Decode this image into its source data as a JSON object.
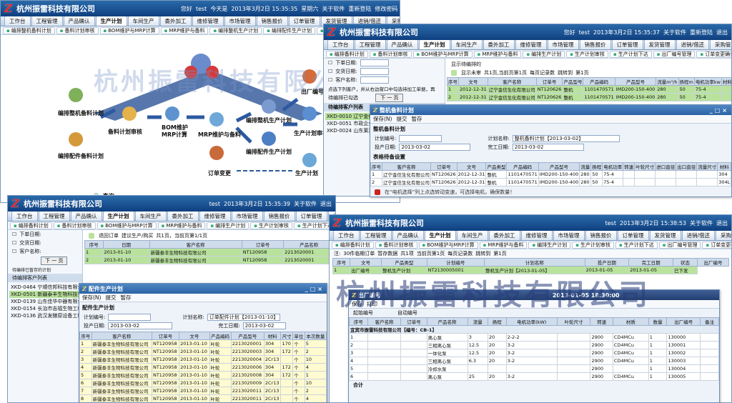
{
  "company": "杭州振雷科技有限公司",
  "logo": "Z",
  "topbar": {
    "welcome": "您好",
    "user": "test",
    "today": "今天是",
    "date": "2013年3月2日 15:35:35",
    "weekday": "星期六",
    "about": "关于软件",
    "switch": "重新登陆",
    "password": "修改密码",
    "exit": "退出"
  },
  "date3": "2013年3月2日 15:35:39",
  "date2": "2013年3月2日 15:35:37",
  "date4": "2013年3月2日 15:38:53",
  "tabs": [
    "工作台",
    "工程管理",
    "产品确认",
    "生产计划",
    "车间生产",
    "委外加工",
    "维修管理",
    "市场管理",
    "销售报价",
    "订单管理",
    "发货管理",
    "进销/借还",
    "采购管理",
    "仓储管理"
  ],
  "subtabs": [
    "编排整机备料计划",
    "备料计划审核",
    "BOM维护与MRP计算",
    "MRP维护与备料",
    "编排整机生产计划",
    "编排配件生产计划",
    "生产计划审核",
    "生产计划下达",
    "出厂编号管理"
  ],
  "subtabs2": [
    "编排备料计划",
    "备料计划审核",
    "BOM维护与MRP计算",
    "MRP维护与备料",
    "编排生产计划",
    "生产计划审核",
    "生产计划下达",
    "出厂编号管理",
    "订单变更确认",
    "变更统计"
  ],
  "flow": {
    "n1": "编排整机备料计划",
    "n2": "编排配件备料计划",
    "n3": "备料计划审核",
    "n4a": "BOM维护",
    "n4b": "MRP计算",
    "n5": "MRP维护与备料",
    "n6": "编排整机生产计划",
    "n7": "编排配件生产计划",
    "n8": "生产计划审核",
    "n9": "生产计划",
    "n10": "订单变更",
    "n11": "出厂编号",
    "query": "查询"
  },
  "watermark": "杭州振雷科技有限公司",
  "filters": {
    "order_date": "下单日期:",
    "delivery_date": "交货日期:",
    "customer": "客户名称:",
    "next": "下 一 页"
  },
  "select_hint": "点选下列客户，并从右边窗口中勾选待加工单据，再",
  "pending": "待编排已勾选",
  "pending2": "待编排已暂存的计划",
  "cust_list_title": "待编排客户列表",
  "w2": {
    "customers": [
      "XKD-0010 辽宁金信生化有限公司",
      "XKD-0051 市政企业华宁",
      "XKD-0024 山东莱港化工"
    ],
    "pending_title": "显示待编排的",
    "status": "显示未审",
    "grid_hint": "共1页,当前页第1页",
    "perpage": "每页记录数",
    "go": "跳转到",
    "page": "第1页",
    "head": [
      "序号",
      "文号",
      "客户名称",
      "订单号",
      "产品型号",
      "产品编码",
      "产品型号",
      "流量m³/h",
      "扬程m",
      "电机功率kw",
      "材料",
      "密封",
      "叶轮尺寸",
      "数量",
      "单位"
    ],
    "rows": [
      [
        "1",
        "2012-12-31",
        "辽宁金信生化有限公司",
        "NT120626",
        "整机",
        "1101470571",
        "IMD200-150-400",
        "280",
        "50",
        "75-4",
        "",
        "双机封",
        "",
        "1",
        "台"
      ],
      [
        "2",
        "2012-12-31",
        "辽宁金信生化有限公司",
        "NT120626",
        "整机",
        "1101470571",
        "IMD200-150-400",
        "280",
        "50",
        "75-4",
        "",
        "双机封",
        "",
        "1",
        "台"
      ]
    ]
  },
  "dlg2": {
    "title": "整机备料计划",
    "toolbar": [
      "保存(N)",
      "提交",
      "暂存"
    ],
    "section": "整机备料计划",
    "plan_no_label": "计划编号:",
    "plan_no": "",
    "plan_name_label": "计划名称:",
    "plan_name": "整机备料计划【2013-03-02】",
    "date_label": "投产日期:",
    "date": "2013-03-02",
    "done_label": "完工日期:",
    "done": "2013-03-02",
    "detail": "表格待备设置",
    "head": [
      "序号",
      "客户名称",
      "订单号",
      "文号",
      "产品类型",
      "产品编码",
      "产品型号",
      "流量",
      "扬程",
      "电机功率",
      "转速",
      "叶轮尺寸",
      "进口直径",
      "出口直径",
      "流量尺寸",
      "材料",
      "密封",
      "数量"
    ],
    "rows": [
      [
        "1",
        "辽宁金信生化有限公司",
        "NT120626",
        "2012-12-31",
        "整机",
        "1101470571",
        "IMD200-150-400",
        "280",
        "50",
        "75-4",
        "",
        "",
        "",
        "",
        "",
        "304",
        "",
        "1"
      ],
      [
        "2",
        "辽宁金信生化有限公司",
        "NT120626",
        "2012-12-31",
        "整机",
        "1101470571",
        "IMD200-150-400",
        "280",
        "50",
        "75-4",
        "",
        "",
        "",
        "",
        "",
        "304L",
        "",
        "1"
      ]
    ],
    "note": "在“电机选择”列上点选转动变速，可选择电机，确保数量！"
  },
  "w3": {
    "tree": [
      "XKD-0464 宁顺信邦科技有限公司",
      "XKD-0501 新疆泰丰生物科技有限公司",
      "XKD-0139 山东佳华中器有限公司",
      "XKD-0154 长治市吉福生物工程有限公司",
      "XKD-0136 武汉发酵原设备工程"
    ],
    "legend": [
      "退回订单",
      "建议生产/购买",
      "共1页，当前页第1/1页"
    ],
    "head": [
      "序号",
      "日期",
      "客户名称",
      "订单号",
      "产品名称"
    ],
    "rows": [
      [
        "1",
        "2013-01-10",
        "新疆泰丰生物科技有限公司",
        "NT120958",
        "2213020001"
      ],
      [
        "2",
        "2013-01-10",
        "新疆泰丰生物科技有限公司",
        "NT120958",
        "2213020001"
      ]
    ],
    "status": "待处理"
  },
  "dlg3": {
    "title": "配件生产计划",
    "toolbar": [
      "保存(N)",
      "提交",
      "暂存"
    ],
    "section": "配件生产计划",
    "plan_no_label": "计划编号:",
    "plan_name_label": "计划名称:",
    "plan_name": "订单配件计划【2013-01-10】",
    "date_label": "投产日期:",
    "date": "2013-03-02",
    "done_label": "完工日期:",
    "done": "2013-03-02",
    "head": [
      "序号",
      "客户名称",
      "订单号",
      "文号",
      "产品编码",
      "产品型号",
      "材料",
      "尺寸",
      "单位",
      "本次数量"
    ],
    "rows": [
      [
        "1",
        "新疆泰丰生物科技有限公司",
        "NT120958",
        "2013-01-10",
        "叶轮",
        "2213020001",
        "304",
        "170",
        "个",
        "5"
      ],
      [
        "2",
        "新疆泰丰生物科技有限公司",
        "NT120958",
        "2013-01-10",
        "叶轮",
        "2213020003",
        "304",
        "172",
        "个",
        "2"
      ],
      [
        "3",
        "新疆泰丰生物科技有限公司",
        "NT120958",
        "2013-01-10",
        "叶轮",
        "2213020004",
        "2Cr13",
        "",
        "个",
        "10"
      ],
      [
        "4",
        "新疆泰丰生物科技有限公司",
        "NT120958",
        "2013-01-10",
        "叶轮",
        "2213020006",
        "304",
        "172",
        "个",
        "4"
      ],
      [
        "5",
        "新疆泰丰生物科技有限公司",
        "NT120958",
        "2013-01-10",
        "叶轮",
        "2213020008",
        "304",
        "172",
        "个",
        "1"
      ],
      [
        "6",
        "新疆泰丰生物科技有限公司",
        "NT120958",
        "2013-01-10",
        "叶轮",
        "2213020009",
        "2Cr13",
        "",
        "个",
        "10"
      ],
      [
        "7",
        "新疆泰丰生物科技有限公司",
        "NT120958",
        "2013-01-10",
        "叶轮",
        "2213020011",
        "2Cr13",
        "",
        "个",
        "2"
      ],
      [
        "8",
        "新疆泰丰生物科技有限公司",
        "NT120958",
        "2013-01-10",
        "叶轮",
        "2213020011",
        "2Cr13",
        "",
        "个",
        "4"
      ],
      [
        "9",
        "新疆泰丰生物科技有限公司",
        "NT120958",
        "2013-01-10",
        "叶轮",
        "2213020013",
        "304",
        "",
        "个",
        "5"
      ],
      [
        "10",
        "新疆泰丰生物科技有限公司",
        "NT120958",
        "2013-01-10",
        "叶轮",
        "2213020014",
        "2Cr13",
        "",
        "个",
        "2"
      ]
    ]
  },
  "w4": {
    "bar": [
      "注:",
      "30件临期订单",
      "暂存数据",
      "共1项",
      "当前页第1页",
      "每页记录数",
      "跳转到",
      "第1页"
    ],
    "head": [
      "序号",
      "文号",
      "产品类型",
      "计划编号",
      "计划名称",
      "投产日期",
      "完工日期",
      "状态",
      "出厂编号"
    ],
    "row": [
      "1",
      "出厂编号",
      "整机生产计划",
      "NT2130005001",
      "整机生产计划【2013-01-05】",
      "2013-01-05",
      "2013-01-05",
      "已下发"
    ]
  },
  "dlg4": {
    "title": "出厂编号",
    "date": "2013-01-05 18:30:00",
    "toolbar": [
      "保存",
      "打印"
    ],
    "order_label": "起始编号",
    "auto_label": "自动编号",
    "head": [
      "序号",
      "客户名称",
      "订单号",
      "产品名称",
      "流量",
      "扬程",
      "电机功率(kW)",
      "叶轮尺寸",
      "转速",
      "材质",
      "数量",
      "出厂编号",
      "备注"
    ],
    "group": "宜宾市振雷科技有限公司【编号：CB-1】",
    "rows": [
      [
        "1",
        "",
        "",
        "离心泵",
        "3",
        "20",
        "2-2-2",
        "",
        "2900",
        "CD4MCu",
        "1",
        "130000",
        ""
      ],
      [
        "2",
        "",
        "",
        "三相离心泵",
        "12.5",
        "20",
        "3-2",
        "",
        "2900",
        "CD4MCu",
        "1",
        "130001",
        ""
      ],
      [
        "3",
        "",
        "",
        "一体化泵",
        "12.5",
        "20",
        "3-2",
        "",
        "2900",
        "CD4MCu",
        "1",
        "130002",
        ""
      ],
      [
        "4",
        "",
        "",
        "三相离心泵",
        "6.3",
        "20",
        "3-2",
        "",
        "2900",
        "CD4MCu",
        "1",
        "130003",
        ""
      ],
      [
        "5",
        "",
        "",
        "冷却水泵",
        "",
        "",
        "",
        "",
        "2900",
        "",
        "1",
        "130004",
        ""
      ],
      [
        "6",
        "",
        "",
        "离心泵",
        "25",
        "20",
        "3-2",
        "",
        "2900",
        "CD4MCu",
        "1",
        "130005",
        ""
      ]
    ],
    "total": "合计"
  },
  "colors": {
    "titlebar": "#1d4f8f",
    "green": "#b9e29c",
    "accent": "#e02020"
  }
}
